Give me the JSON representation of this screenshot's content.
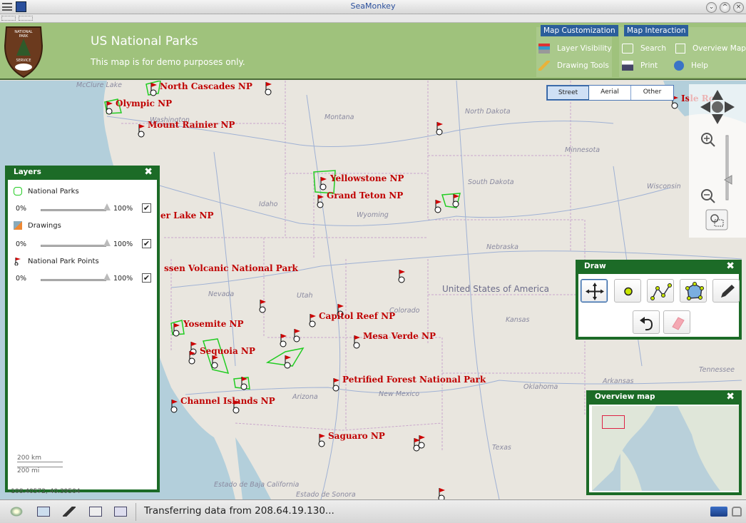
{
  "window": {
    "title": "SeaMonkey",
    "buttons": [
      "minimize",
      "maximize",
      "close"
    ]
  },
  "header": {
    "title": "US National Parks",
    "subtitle": "This map is for demo purposes only.",
    "logo_text": [
      "NATIONAL",
      "PARK",
      "SERVICE"
    ],
    "groups": [
      {
        "tab": "Map Customization",
        "items": [
          {
            "label": "Layer Visibility",
            "icon": "layers-icon"
          },
          {
            "label": "Drawing Tools",
            "icon": "pencil-icon"
          }
        ]
      },
      {
        "tab": "Map Interaction",
        "items": [
          {
            "label": "Search",
            "icon": "search-icon"
          },
          {
            "label": "Overview Map",
            "icon": "overview-icon"
          },
          {
            "label": "Print",
            "icon": "print-icon"
          },
          {
            "label": "Help",
            "icon": "help-icon"
          }
        ]
      }
    ]
  },
  "map": {
    "basemaps": {
      "street": "Street",
      "aerial": "Aerial",
      "other": "Other",
      "selected": "Street"
    },
    "country_label": "United States of America",
    "states": {
      "washington": "Washington",
      "montana": "Montana",
      "north_dakota": "North Dakota",
      "minnesota": "Minnesota",
      "south_dakota": "South Dakota",
      "wisconsin": "Wisconsin",
      "idaho": "Idaho",
      "wyoming": "Wyoming",
      "nebraska": "Nebraska",
      "nevada": "Nevada",
      "utah": "Utah",
      "colorado": "Colorado",
      "kansas": "Kansas",
      "arizona": "Arizona",
      "new_mexico": "New Mexico",
      "oklahoma": "Oklahoma",
      "texas": "Texas",
      "arkansas": "Arkansas",
      "tennessee": "Tennessee",
      "baja": "Estado de Baja California",
      "sonora": "Estado de Sonora",
      "mcclure": "McClure Lake"
    },
    "parks": {
      "north_cascades": "North Cascades NP",
      "olympic": "Olympic NP",
      "mount_rainier": "Mount Rainier NP",
      "yellowstone": "Yellowstone NP",
      "grand_teton": "Grand Teton NP",
      "crater_lake": "er Lake NP",
      "lassen": "ssen Volcanic National Park",
      "capitol_reef": "Capitol Reef NP",
      "mesa_verde": "Mesa Verde NP",
      "yosemite": "Yosemite NP",
      "sequoia": "Sequoia NP",
      "petrified_forest": "Petrified Forest National Park",
      "channel_islands": "Channel Islands NP",
      "saguaro": "Saguaro NP",
      "isle_royale": "Isle Ro"
    },
    "coords": "-108.40572, 40.39504",
    "scale": {
      "km": "200 km",
      "mi": "200 mi"
    }
  },
  "layers_panel": {
    "title": "Layers",
    "close": "✖",
    "layers": [
      {
        "name": "National Parks",
        "min": "0%",
        "max": "100%",
        "opacity": 1.0,
        "visible": true
      },
      {
        "name": "Drawings",
        "min": "0%",
        "max": "100%",
        "opacity": 1.0,
        "visible": true
      },
      {
        "name": "National Park Points",
        "min": "0%",
        "max": "100%",
        "opacity": 1.0,
        "visible": true
      }
    ]
  },
  "draw_panel": {
    "title": "Draw",
    "close": "✖",
    "tools": [
      "pan-icon",
      "point-icon",
      "line-icon",
      "polygon-icon",
      "pencil-icon"
    ],
    "actions": [
      "undo-icon",
      "eraser-icon"
    ]
  },
  "overview_panel": {
    "title": "Overview map",
    "close": "✖"
  },
  "status": {
    "text": "Transferring data from 208.64.19.130..."
  },
  "colors": {
    "header_green": "#9fc27c",
    "panel_green": "#1c6b27",
    "tab_blue": "#2b5e9b",
    "park_label_red": "#c00000",
    "park_outline": "#22cc22"
  }
}
